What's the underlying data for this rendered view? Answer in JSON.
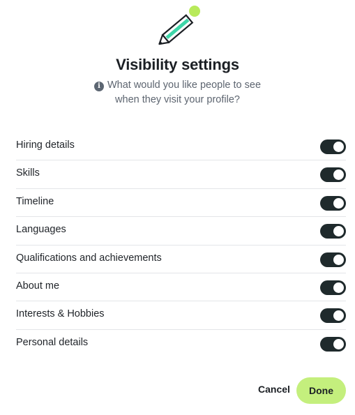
{
  "dialog": {
    "icon": "pencil-icon",
    "title": "Visibility settings",
    "subtitle_line1": "What would you like people to see",
    "subtitle_line2": "when they visit your profile?",
    "info_icon": "info-icon",
    "info_glyph": "i"
  },
  "settings": [
    {
      "label": "Hiring details",
      "enabled": true
    },
    {
      "label": "Skills",
      "enabled": true
    },
    {
      "label": "Timeline",
      "enabled": true
    },
    {
      "label": "Languages",
      "enabled": true
    },
    {
      "label": "Qualifications and achievements",
      "enabled": true
    },
    {
      "label": "About me",
      "enabled": true
    },
    {
      "label": "Interests & Hobbies",
      "enabled": true
    },
    {
      "label": "Personal details",
      "enabled": true
    }
  ],
  "actions": {
    "cancel_label": "Cancel",
    "done_label": "Done"
  },
  "colors": {
    "toggle_on": "#1f2a2c",
    "done_button": "#c4ef7d",
    "pencil_stripe": "#3ed6a8",
    "pencil_eraser": "#b8ea5a"
  }
}
